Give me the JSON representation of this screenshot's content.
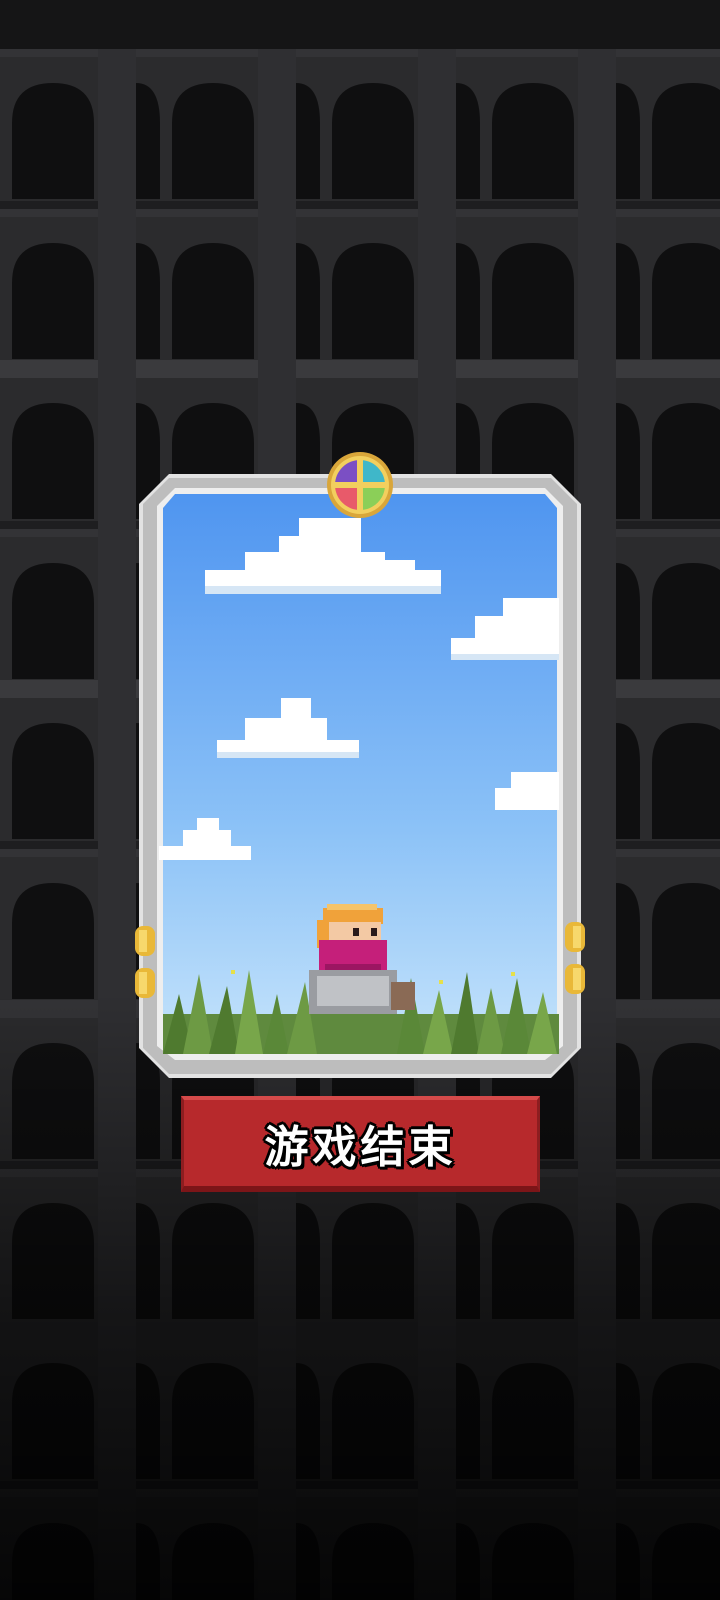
{
  "screen": "game-over",
  "card": {
    "emblem_icon": "four-color-wheel-emblem-icon",
    "character": "blonde-hero-with-magenta-mask",
    "scene": "sky-with-clouds-and-grass"
  },
  "button": {
    "label": "游戏结束"
  },
  "colors": {
    "button_red": "#b7292c",
    "sky_top": "#4f95f0",
    "sky_bottom": "#bfe0fb",
    "frame": "#dcdcdc",
    "background": "#1a1a1b"
  }
}
